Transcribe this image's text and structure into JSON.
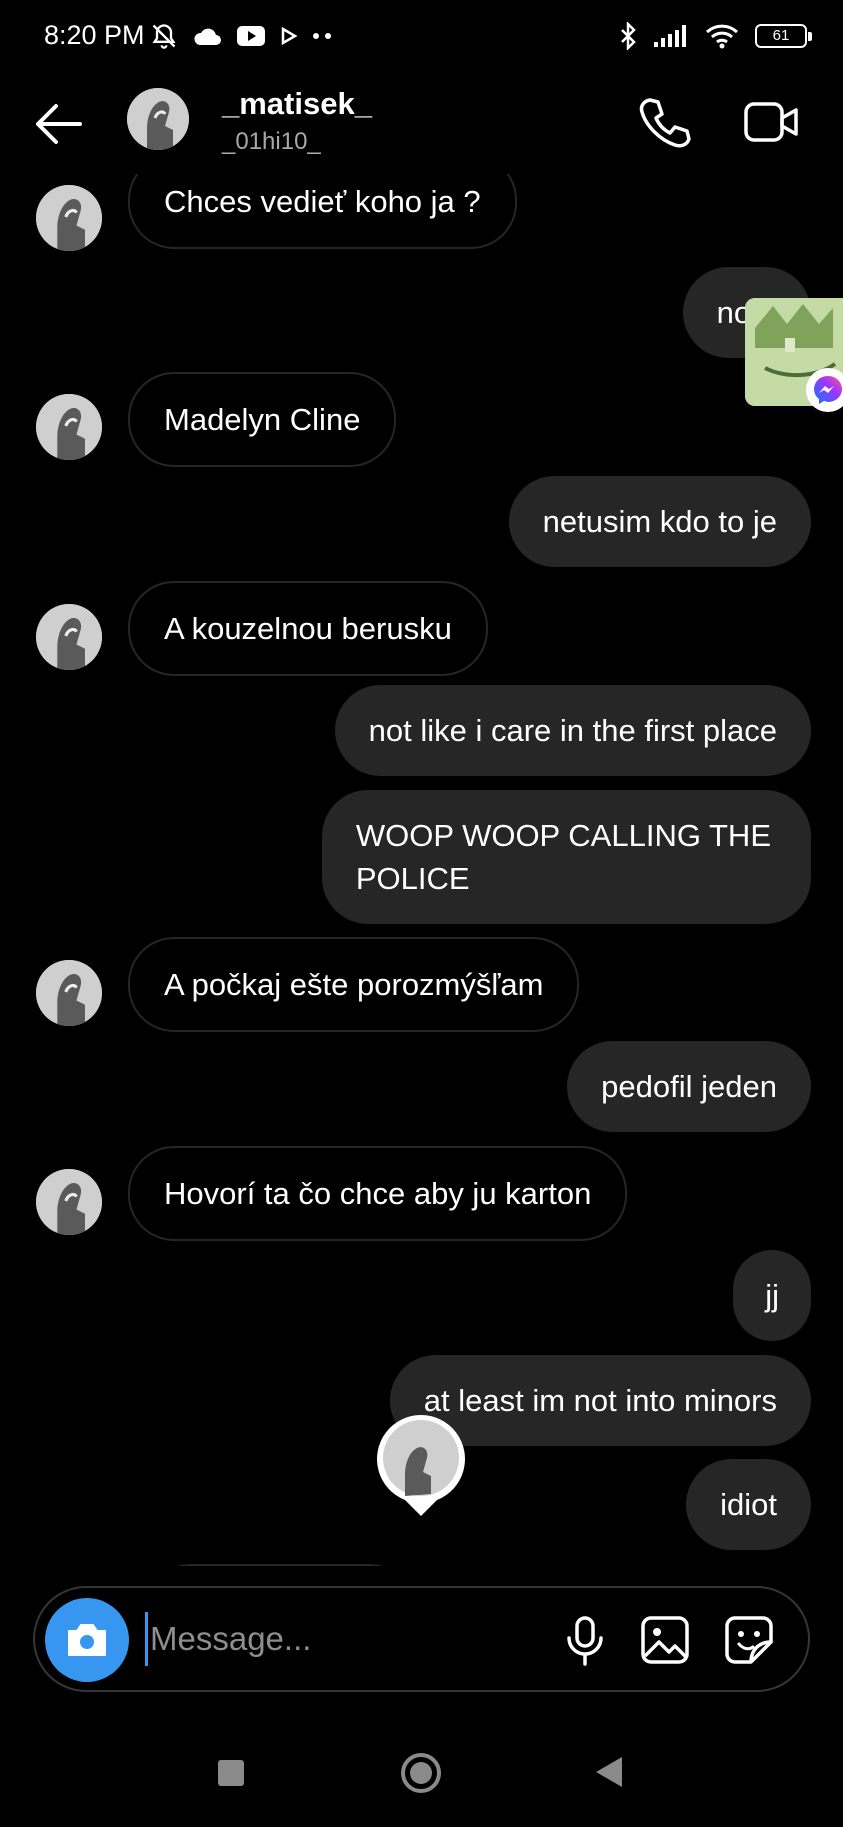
{
  "status_bar": {
    "time": "8:20 PM",
    "battery": "61",
    "left_icons": [
      "bell-off-icon",
      "cloud-icon",
      "youtube-icon",
      "play-icon",
      "dots-icon"
    ],
    "right_icons": [
      "bluetooth-icon",
      "signal-icon",
      "wifi-icon",
      "battery-icon"
    ]
  },
  "header": {
    "name": "_matisek_",
    "handle": "_01hi10_",
    "icons": [
      "back-arrow-icon",
      "phone-icon",
      "video-camera-icon"
    ]
  },
  "messages": [
    {
      "side": "incoming",
      "text": "Chces vedieť koho ja ?"
    },
    {
      "side": "outgoing",
      "text": "no d"
    },
    {
      "side": "incoming",
      "text": "Madelyn Cline"
    },
    {
      "side": "outgoing",
      "text": "netusim kdo to je"
    },
    {
      "side": "incoming",
      "text": "A kouzelnou berusku"
    },
    {
      "side": "outgoing",
      "text": "not like i care in the first place"
    },
    {
      "side": "outgoing",
      "text": "WOOP WOOP CALLING THE",
      "text2": "POLICE"
    },
    {
      "side": "incoming",
      "text": "A počkaj ešte porozmýšľam"
    },
    {
      "side": "outgoing",
      "text": "pedofil jeden"
    },
    {
      "side": "incoming",
      "text": "Hovorí ta čo chce aby ju karton"
    },
    {
      "side": "outgoing",
      "text": "jj"
    },
    {
      "side": "outgoing",
      "text": "at least im not into minors"
    },
    {
      "side": "outgoing",
      "text": "idiot"
    }
  ],
  "composer": {
    "placeholder": "Message...",
    "icons": [
      "camera-icon",
      "microphone-icon",
      "gallery-icon",
      "sticker-icon"
    ],
    "accent": "#3797f0"
  },
  "colors": {
    "background": "#000000",
    "outgoing_bubble": "#262626",
    "incoming_border": "#262626",
    "muted_text": "#a8a8a8"
  },
  "nav_bar": {
    "icons": [
      "recent-apps-icon",
      "home-icon",
      "back-icon"
    ]
  }
}
